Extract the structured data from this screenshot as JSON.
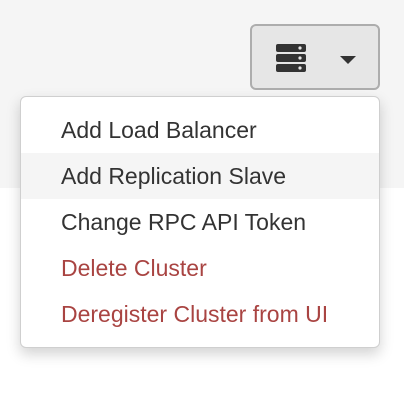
{
  "toolbar": {
    "toggle_icon": "server-stack-icon",
    "caret_icon": "caret-down-icon"
  },
  "menu": {
    "items": [
      {
        "label": "Add Load Balancer",
        "style": "default"
      },
      {
        "label": "Add Replication Slave",
        "style": "hover"
      },
      {
        "label": "Change RPC API Token",
        "style": "default"
      },
      {
        "label": "Delete Cluster",
        "style": "danger"
      },
      {
        "label": "Deregister Cluster from UI",
        "style": "danger"
      }
    ]
  },
  "colors": {
    "text": "#333333",
    "danger": "#a94442",
    "hover_background": "#f5f5f5",
    "button_background": "#e6e6e6"
  }
}
